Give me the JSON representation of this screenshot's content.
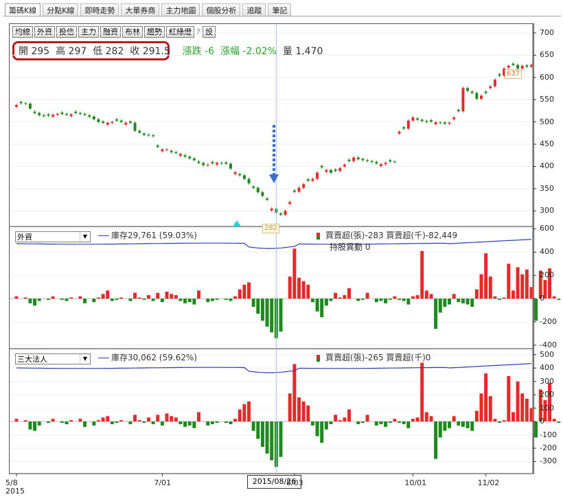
{
  "tabs": [
    {
      "label": "籌碼K線",
      "active": true
    },
    {
      "label": "分點K線",
      "active": false
    },
    {
      "label": "即時走勢",
      "active": false
    },
    {
      "label": "大單券商",
      "active": false
    },
    {
      "label": "主力地圖",
      "active": false
    },
    {
      "label": "個股分析",
      "active": false
    },
    {
      "label": "追蹤",
      "active": false
    },
    {
      "label": "筆記",
      "active": false
    }
  ],
  "toolbar": {
    "buttons": [
      "均線",
      "外資",
      "投信",
      "主力",
      "融資",
      "布林",
      "趨勢",
      "紅綠燈"
    ],
    "help": "?",
    "settings": "設"
  },
  "quote": {
    "open_label": "開",
    "open": "295",
    "high_label": "高",
    "high": "297",
    "low_label": "低",
    "low": "282",
    "close_label": "收",
    "close": "291.5",
    "change_label": "漲跌",
    "change": "-6",
    "pct_label": "漲幅",
    "pct": "-2.02%",
    "volume_label": "量",
    "volume": "1,470"
  },
  "price_markers": {
    "high_tag": "637",
    "low_tag": "282"
  },
  "panels": {
    "foreign": {
      "selector": "外資",
      "inventory": "庫存29,761 (59.03%)",
      "net": "買賣超(張)-283 買賣超(千)-82,449",
      "holding_change": "持股異動 0"
    },
    "institutional": {
      "selector": "三大法人",
      "inventory": "庫存30,062 (59.62%)",
      "net": "買賣超(張)-265 買賣超(千)0"
    }
  },
  "cursor_date": "2015/08/26",
  "colors": {
    "up": "#e42b2b",
    "down": "#1e8a1e",
    "line": "#2b3cab",
    "arrow": "#3a6fd0",
    "highlight": "#b21e1e"
  },
  "chart_data": [
    {
      "type": "candlestick",
      "title": "K線",
      "ylim": [
        265,
        720
      ],
      "yticks": [
        "700",
        "650",
        "600",
        "550",
        "500",
        "450",
        "400",
        "350",
        "300"
      ],
      "x_ticks": [
        "5/8",
        "7/01",
        "8/03",
        "10/01",
        "11/02"
      ],
      "x_year": "2015",
      "close": [
        538,
        542,
        541,
        530,
        520,
        515,
        513,
        514,
        516,
        518,
        518,
        516,
        517,
        520,
        518,
        516,
        512,
        506,
        500,
        498,
        498,
        500,
        503,
        500,
        498,
        498,
        480,
        476,
        471,
        470,
        468,
        444,
        438,
        438,
        432,
        430,
        428,
        422,
        418,
        414,
        408,
        403,
        404,
        407,
        408,
        407,
        406,
        395,
        387,
        380,
        372,
        362,
        352,
        342,
        334,
        325,
        305,
        296,
        291.5,
        300,
        320,
        343,
        352,
        360,
        368,
        372,
        386,
        398,
        392,
        386,
        390,
        396,
        404,
        412,
        420,
        416,
        414,
        412,
        410,
        407,
        405,
        408,
        411,
        410,
        478,
        485,
        503,
        510,
        505,
        502,
        500,
        501,
        499,
        498,
        496,
        498,
        510,
        524,
        576,
        570,
        565,
        552,
        559,
        565,
        580,
        595,
        604,
        620,
        626,
        628,
        620,
        626,
        624,
        628
      ]
    },
    {
      "type": "bar",
      "title": "外資",
      "ylim": [
        -430,
        620
      ],
      "yticks": [
        "600",
        "400",
        "200",
        "0",
        "-200",
        "-400"
      ],
      "values": [
        20,
        0,
        10,
        -40,
        -60,
        -20,
        0,
        -10,
        20,
        0,
        -10,
        -20,
        10,
        0,
        20,
        -40,
        0,
        -30,
        10,
        40,
        70,
        -20,
        -10,
        10,
        0,
        -20,
        50,
        10,
        -10,
        30,
        -20,
        50,
        -30,
        60,
        40,
        30,
        -20,
        -40,
        -30,
        -50,
        70,
        0,
        -30,
        -20,
        -10,
        0,
        -10,
        -20,
        20,
        80,
        120,
        140,
        -70,
        -130,
        -190,
        -240,
        -290,
        -340,
        -283,
        0,
        190,
        430,
        180,
        150,
        120,
        -30,
        -110,
        -160,
        -60,
        -20,
        50,
        10,
        30,
        90,
        0,
        -20,
        -10,
        50,
        0,
        -30,
        -20,
        -40,
        -10,
        20,
        -10,
        -20,
        -50,
        20,
        30,
        410,
        70,
        40,
        -260,
        -120,
        -70,
        -50,
        40,
        -30,
        -40,
        -50,
        -70,
        80,
        210,
        390,
        190,
        20,
        -10,
        10,
        300,
        70,
        270,
        210,
        250,
        100,
        -190,
        240,
        160,
        260,
        20,
        -10
      ]
    },
    {
      "type": "bar",
      "title": "三大法人",
      "ylim": [
        -390,
        545
      ],
      "yticks": [
        "500",
        "400",
        "300",
        "200",
        "100",
        "0",
        "-100",
        "-200",
        "-300"
      ],
      "values": [
        20,
        0,
        10,
        -60,
        -70,
        -30,
        0,
        -10,
        20,
        0,
        -10,
        -20,
        10,
        0,
        20,
        -40,
        0,
        -30,
        10,
        30,
        40,
        -20,
        -10,
        10,
        0,
        -20,
        50,
        10,
        -10,
        30,
        -20,
        50,
        -30,
        60,
        40,
        30,
        -20,
        -40,
        -30,
        -50,
        70,
        0,
        -30,
        -20,
        -10,
        0,
        -10,
        -20,
        20,
        90,
        130,
        150,
        -70,
        -130,
        -190,
        -240,
        -290,
        -340,
        -265,
        0,
        210,
        430,
        180,
        150,
        120,
        -30,
        -110,
        -160,
        -60,
        -20,
        50,
        10,
        30,
        90,
        0,
        -20,
        -10,
        50,
        0,
        -30,
        -20,
        -40,
        -10,
        20,
        -10,
        -20,
        -50,
        20,
        30,
        440,
        70,
        40,
        -280,
        -120,
        -70,
        -50,
        40,
        -30,
        -40,
        -50,
        -70,
        80,
        210,
        360,
        190,
        20,
        -10,
        10,
        340,
        70,
        300,
        210,
        170,
        100,
        -120,
        240,
        160,
        290,
        20,
        -10
      ]
    }
  ]
}
